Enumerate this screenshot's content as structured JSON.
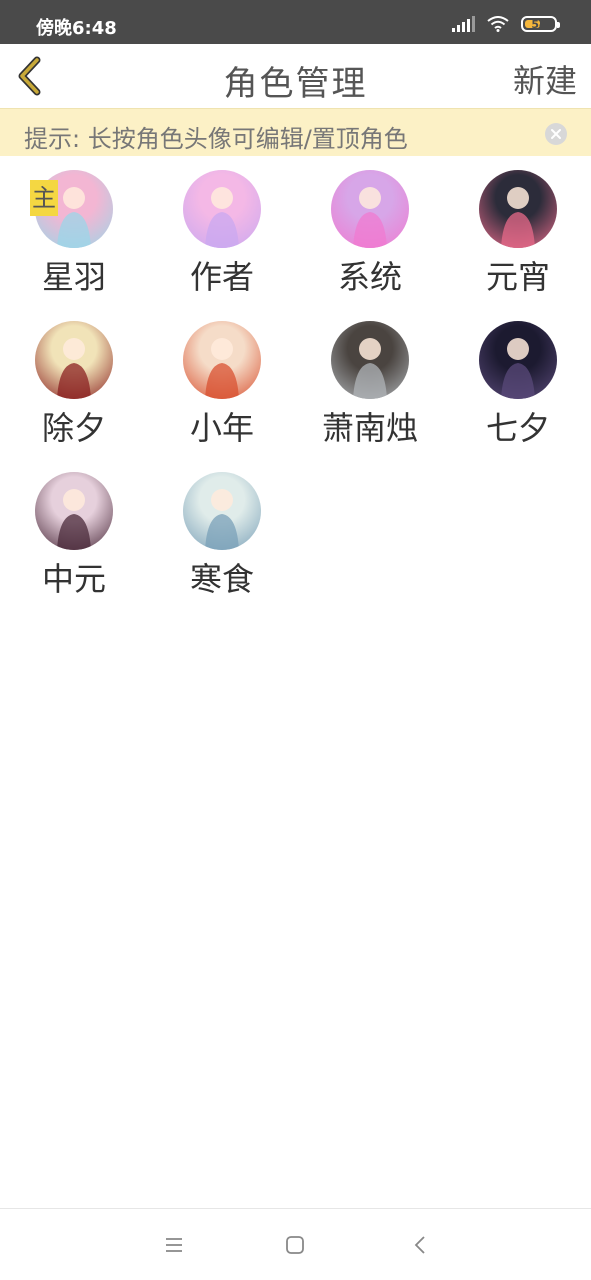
{
  "status_bar": {
    "time": "傍晚6:48",
    "battery": "54",
    "icons": [
      "signal-icon",
      "wifi-icon",
      "battery-icon"
    ]
  },
  "header": {
    "title": "角色管理",
    "new_label": "新建",
    "back_icon": "chevron-left-icon",
    "accent_color": "#c8a938"
  },
  "tip": {
    "text": "提示: 长按角色头像可编辑/置顶角色",
    "close_icon": "close-circle-icon",
    "background": "#fcf1c6"
  },
  "roles": [
    {
      "name": "星羽",
      "badge": "主",
      "avatar_colors": [
        "#f3b6d3",
        "#9bd6e8"
      ]
    },
    {
      "name": "作者",
      "avatar_colors": [
        "#f4b8e6",
        "#c9a8f0"
      ]
    },
    {
      "name": "系统",
      "avatar_colors": [
        "#d7a6e8",
        "#f07ad0"
      ]
    },
    {
      "name": "元宵",
      "avatar_colors": [
        "#2c2c3a",
        "#e86a8a"
      ]
    },
    {
      "name": "除夕",
      "avatar_colors": [
        "#f1e3b8",
        "#8a2020"
      ]
    },
    {
      "name": "小年",
      "avatar_colors": [
        "#f5dcc8",
        "#d85030"
      ]
    },
    {
      "name": "萧南烛",
      "avatar_colors": [
        "#4a4440",
        "#b0b4b8"
      ]
    },
    {
      "name": "七夕",
      "avatar_colors": [
        "#1c1a30",
        "#5a4a7a"
      ]
    },
    {
      "name": "中元",
      "avatar_colors": [
        "#e6d0dc",
        "#4a2a3a"
      ]
    },
    {
      "name": "寒食",
      "avatar_colors": [
        "#e0ecea",
        "#7aa0b8"
      ]
    }
  ],
  "nav_bar": {
    "icons": [
      "menu-icon",
      "home-icon",
      "back-icon"
    ]
  }
}
